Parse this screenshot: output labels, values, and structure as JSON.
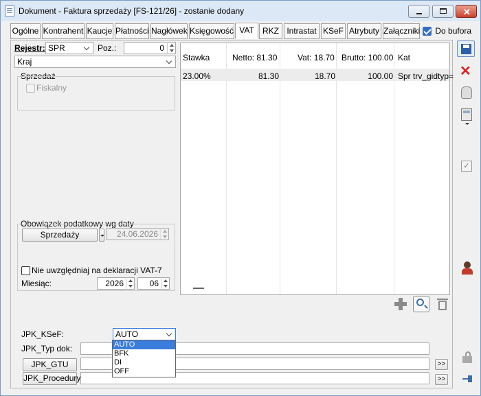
{
  "window": {
    "title": "Dokument - Faktura sprzedaży [FS-121/26]  - zostanie dodany"
  },
  "tabs": [
    {
      "label": "Ogólne"
    },
    {
      "label": "Kontrahent"
    },
    {
      "label": "Kaucje"
    },
    {
      "label": "Płatności"
    },
    {
      "label": "Nagłówek"
    },
    {
      "label": "Księgowość"
    },
    {
      "label": "VAT"
    },
    {
      "label": "RKZ"
    },
    {
      "label": "Intrastat"
    },
    {
      "label": "KSeF"
    },
    {
      "label": "Atrybuty"
    },
    {
      "label": "Załączniki"
    }
  ],
  "active_tab": "VAT",
  "do_bufora": {
    "label": "Do bufora",
    "checked": true
  },
  "left": {
    "rejestr_label": "Rejestr:",
    "rejestr_value": "SPR",
    "poz_label": "Poz.:",
    "poz_value": "0",
    "kraj_value": "Kraj",
    "sprzedaz_group": "Sprzedaż",
    "fiskalny_label": "Fiskalny",
    "obowiazek_group": "Obowiązek podatkowy wg daty",
    "obowiazek_button": "Sprzedaży",
    "obowiazek_date": "24.06.2026",
    "nie_uwzgledniaj": "Nie uwzględniaj na deklaracji VAT-7",
    "miesiac_label": "Miesiąc:",
    "miesiac_year": "2026",
    "miesiac_month": "06"
  },
  "vat_table": {
    "headers": [
      "Stawka",
      "Netto: 81.30",
      "Vat: 18.70",
      "Brutto: 100.00",
      "Kat"
    ],
    "rows": [
      [
        "23.00%",
        "81.30",
        "18.70",
        "100.00",
        "Spr trv_gidtyp="
      ]
    ]
  },
  "jpk": {
    "ksef_label": "JPK_KSeF:",
    "ksef_value": "AUTO",
    "ksef_options": [
      "AUTO",
      "BFK",
      "DI",
      "OFF"
    ],
    "typ_label": "JPK_Typ dok:",
    "gtu_button": "JPK_GTU",
    "procedury_button": "JPK_Procedury",
    "more_label": ">>"
  },
  "icons": [
    "save-icon",
    "delete-icon",
    "hand-icon",
    "calculator-icon",
    "check-icon",
    "user-icon",
    "add-icon",
    "search-icon",
    "trash-icon",
    "lock-icon",
    "pin-icon"
  ]
}
